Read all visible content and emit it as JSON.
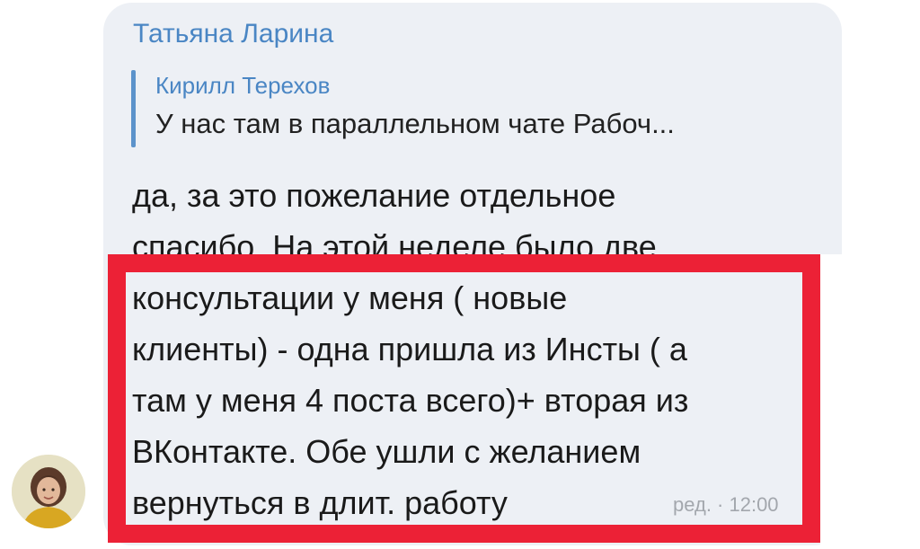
{
  "message": {
    "sender_name": "Татьяна Ларина",
    "reply": {
      "author": "Кирилл Терехов",
      "text": "У нас там в параллельном чате Рабоч..."
    },
    "text_lines": [
      "да, за это пожелание отдельное",
      "спасибо. На этой неделе было две",
      "консультации у меня ( новые",
      "клиенты) - одна пришла из Инсты ( а",
      "там у меня 4 поста всего)+ вторая из",
      "ВКонтакте. Обе ушли с желанием",
      "вернуться в длит. работу"
    ],
    "meta": "ред. · 12:00"
  },
  "colors": {
    "sender": "#4a86c4",
    "bubble": "#edf0f5",
    "highlight_border": "#ec2136"
  }
}
